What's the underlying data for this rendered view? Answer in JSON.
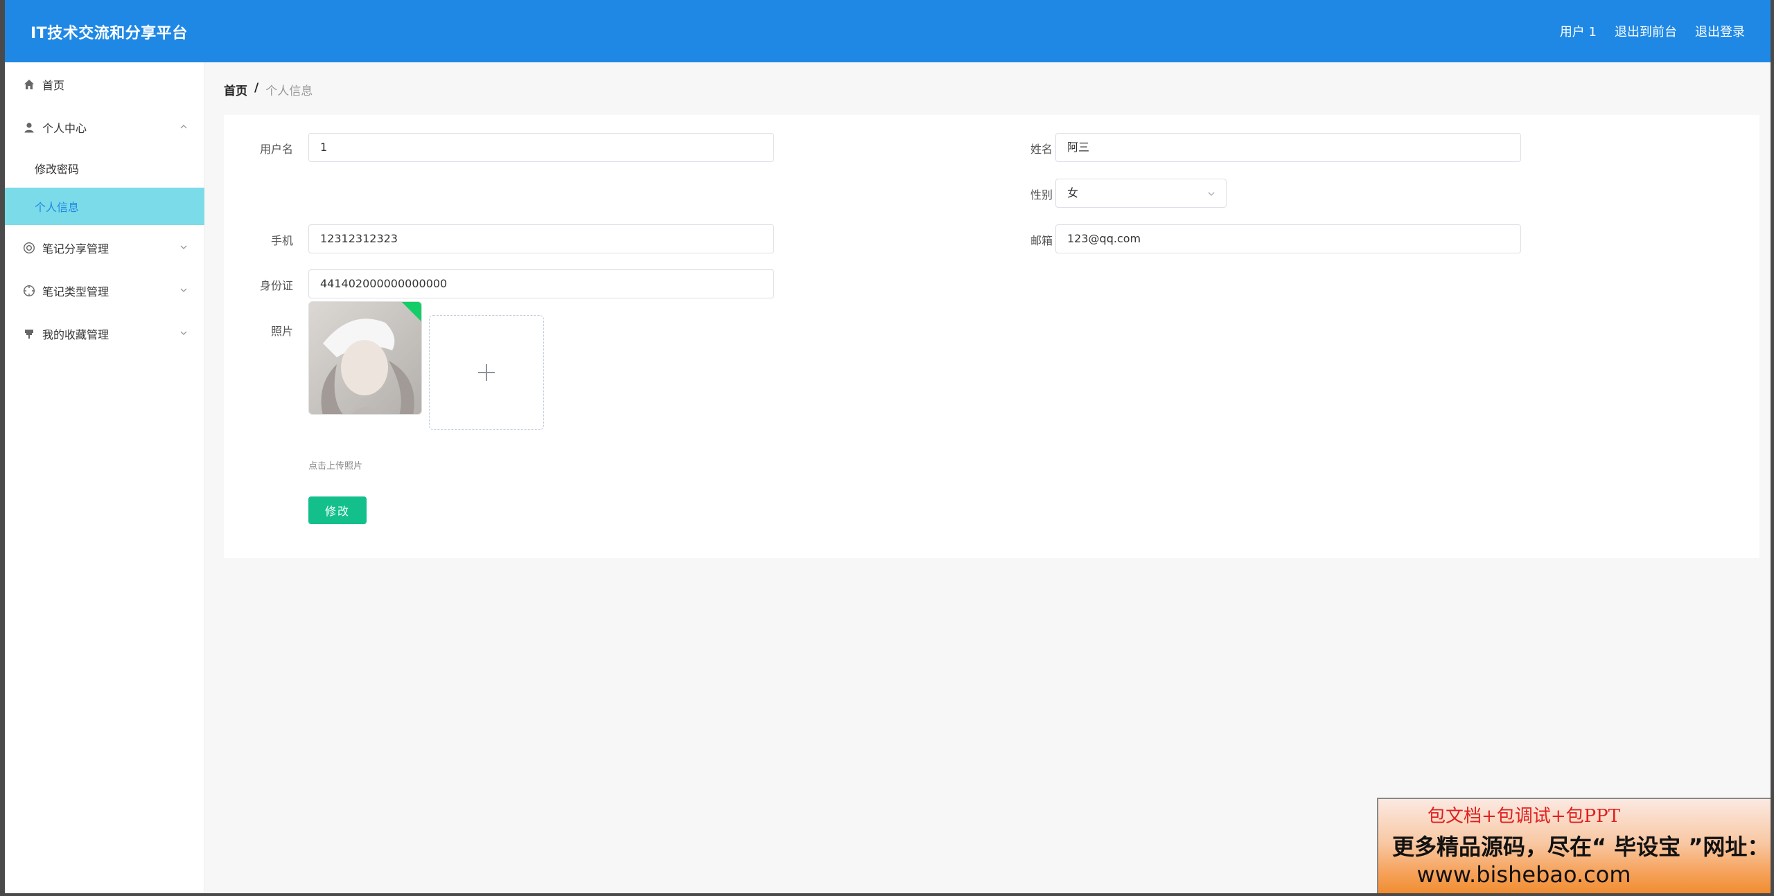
{
  "header": {
    "brand": "IT技术交流和分享平台",
    "nav": [
      "用户 1",
      "退出到前台",
      "退出登录"
    ]
  },
  "sidebar": {
    "items": [
      {
        "label": "首页",
        "icon": "home-icon"
      },
      {
        "label": "个人中心",
        "icon": "user-icon",
        "expanded": true,
        "children": [
          {
            "label": "修改密码"
          },
          {
            "label": "个人信息",
            "active": true
          }
        ]
      },
      {
        "label": "笔记分享管理",
        "icon": "gear-circle-icon"
      },
      {
        "label": "笔记类型管理",
        "icon": "crosshair-icon"
      },
      {
        "label": "我的收藏管理",
        "icon": "pin-icon"
      }
    ]
  },
  "breadcrumb": {
    "home": "首页",
    "sep": "/",
    "current": "个人信息"
  },
  "form": {
    "username_label": "用户名",
    "username_value": "1",
    "name_label": "姓名",
    "name_value": "阿三",
    "gender_label": "性别",
    "gender_value": "女",
    "phone_label": "手机",
    "phone_value": "12312312323",
    "email_label": "邮箱",
    "email_value": "123@qq.com",
    "idcard_label": "身份证",
    "idcard_value": "441402000000000000",
    "photo_label": "照片",
    "upload_tip": "点击上传照片",
    "submit_label": "修改"
  },
  "ad": {
    "line1": "包文档+包调试+包PPT",
    "line2": "更多精品源码，尽在“ 毕设宝 ”网址：",
    "line3": "www.bishebao.com"
  },
  "colors": {
    "header_bg": "#1f88e5",
    "active_menu_bg": "#7bdbe8",
    "submit_bg": "#13c08b"
  }
}
